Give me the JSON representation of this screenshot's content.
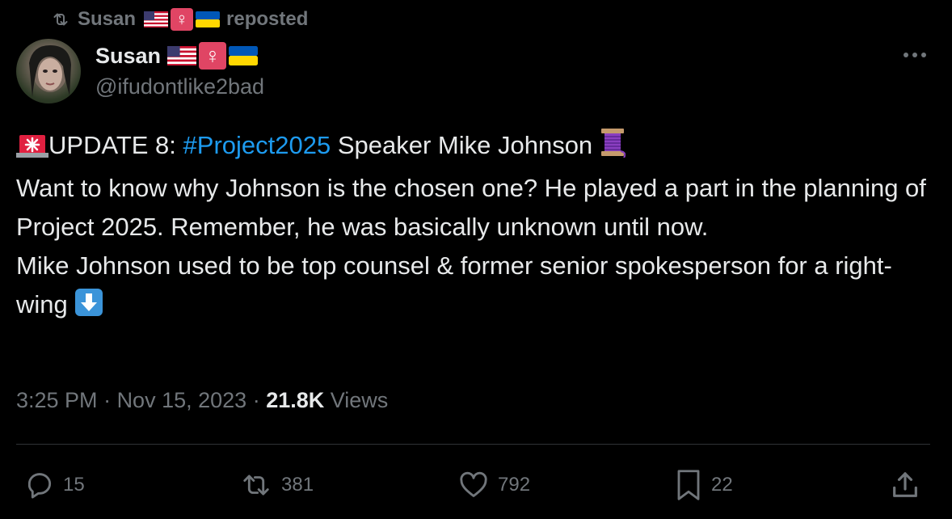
{
  "repost": {
    "user": "Susan",
    "label": "reposted"
  },
  "author": {
    "name": "Susan",
    "handle": "@ifudontlike2bad",
    "badges": [
      "us-flag-emoji",
      "female-sign-emoji",
      "ukraine-flag-emoji"
    ]
  },
  "tweet": {
    "line1_prefix": "UPDATE 8: ",
    "hashtag": "#Project2025",
    "line1_suffix": " Speaker Mike Johnson",
    "paragraph2": "Want to know why Johnson is the chosen one? He played a part in the planning of Project 2025. Remember, he was basically unknown until now.",
    "paragraph3": "Mike Johnson used to be top counsel & former senior spokesperson for a right-wing"
  },
  "meta": {
    "time": "3:25 PM",
    "separator": " · ",
    "date": "Nov 15, 2023",
    "views_count": "21.8K",
    "views_label": " Views"
  },
  "actions": {
    "replies": "15",
    "reposts": "381",
    "likes": "792",
    "bookmarks": "22"
  },
  "colors": {
    "background": "#000000",
    "text": "#e7e9ea",
    "muted": "#71767b",
    "link": "#1d9bf0",
    "divider": "#2f3336"
  }
}
